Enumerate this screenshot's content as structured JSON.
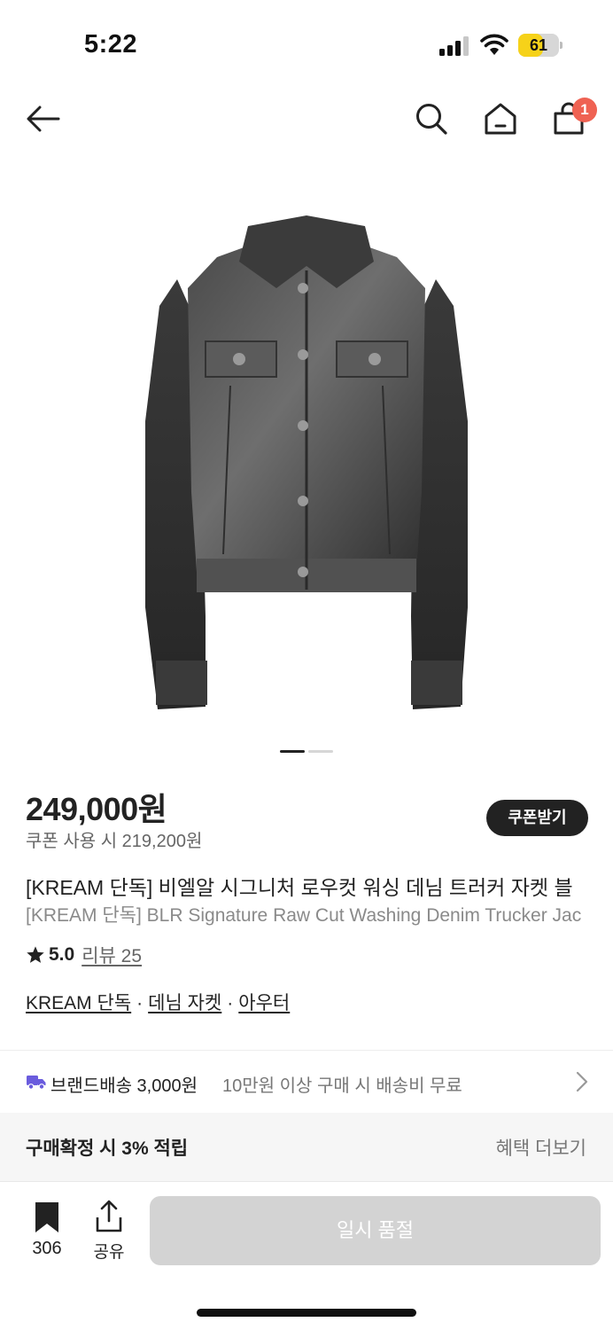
{
  "status_bar": {
    "time": "5:22",
    "battery_level": "61",
    "battery_percent": 61,
    "battery_color": "#f6d219"
  },
  "nav": {
    "back_icon": "arrow-left",
    "search_icon": "magnifier",
    "home_icon": "house",
    "bag_icon": "shopping-bag",
    "bag_badge": "1"
  },
  "product": {
    "image_alt_icon": "denim-jacket",
    "carousel": {
      "current": 1,
      "total": 2
    },
    "price": "249,000원",
    "coupon_price": "쿠폰 사용 시 219,200원",
    "coupon_button": "쿠폰받기",
    "title_ko": "[KREAM 단독] 비엘알 시그니처 로우컷 워싱 데님 트러커 자켓 블",
    "title_en": "[KREAM 단독] BLR Signature Raw Cut Washing Denim Trucker Jac",
    "rating": "5.0",
    "review_link": "리뷰 25",
    "categories": [
      "KREAM 단독",
      "데님 자켓",
      "아우터"
    ],
    "category_separator": "·"
  },
  "shipping": {
    "icon": "truck",
    "title": "브랜드배송 3,000원",
    "description": "10만원 이상 구매 시 배송비 무료",
    "accent_color": "#6a5cdd"
  },
  "benefit": {
    "title": "구매확정 시 3% 적립",
    "more": "혜택 더보기"
  },
  "bottom_bar": {
    "save_count": "306",
    "share_label": "공유",
    "main_button": "일시 품절"
  }
}
